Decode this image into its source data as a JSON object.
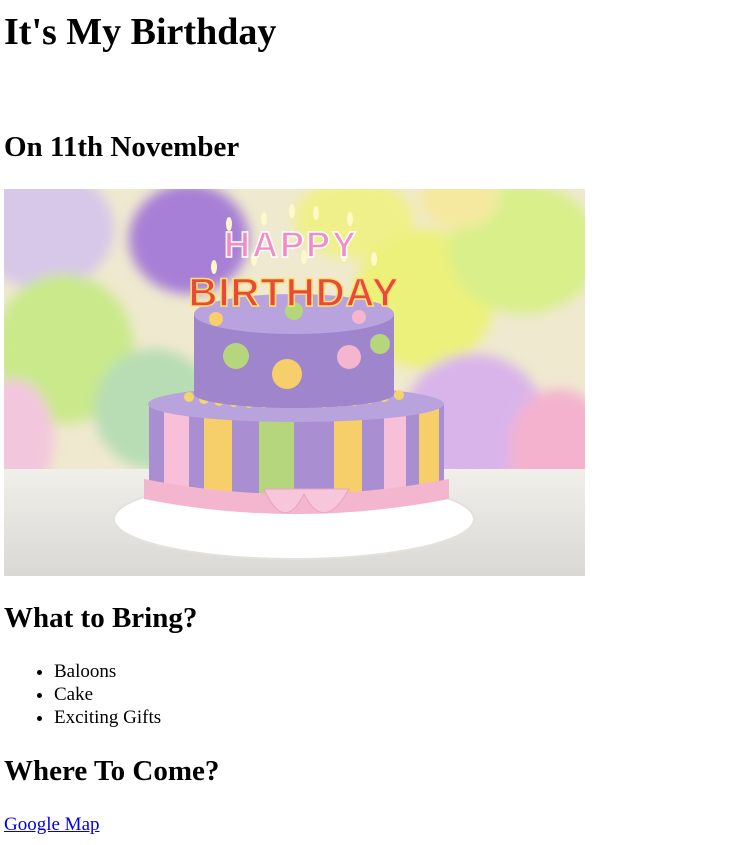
{
  "page": {
    "title": "It's My Birthday",
    "date_heading": "On 11th November"
  },
  "image": {
    "icon": "birthday-cake-photo",
    "topper_line_1": "HAPPY",
    "topper_line_2": "BIRTHDAY"
  },
  "bring": {
    "heading": "What to Bring?",
    "items": [
      "Baloons",
      "Cake",
      "Exciting Gifts"
    ]
  },
  "where": {
    "heading": "Where To Come?",
    "link_text": "Google Map"
  },
  "colors": {
    "link": "#0000ee"
  }
}
